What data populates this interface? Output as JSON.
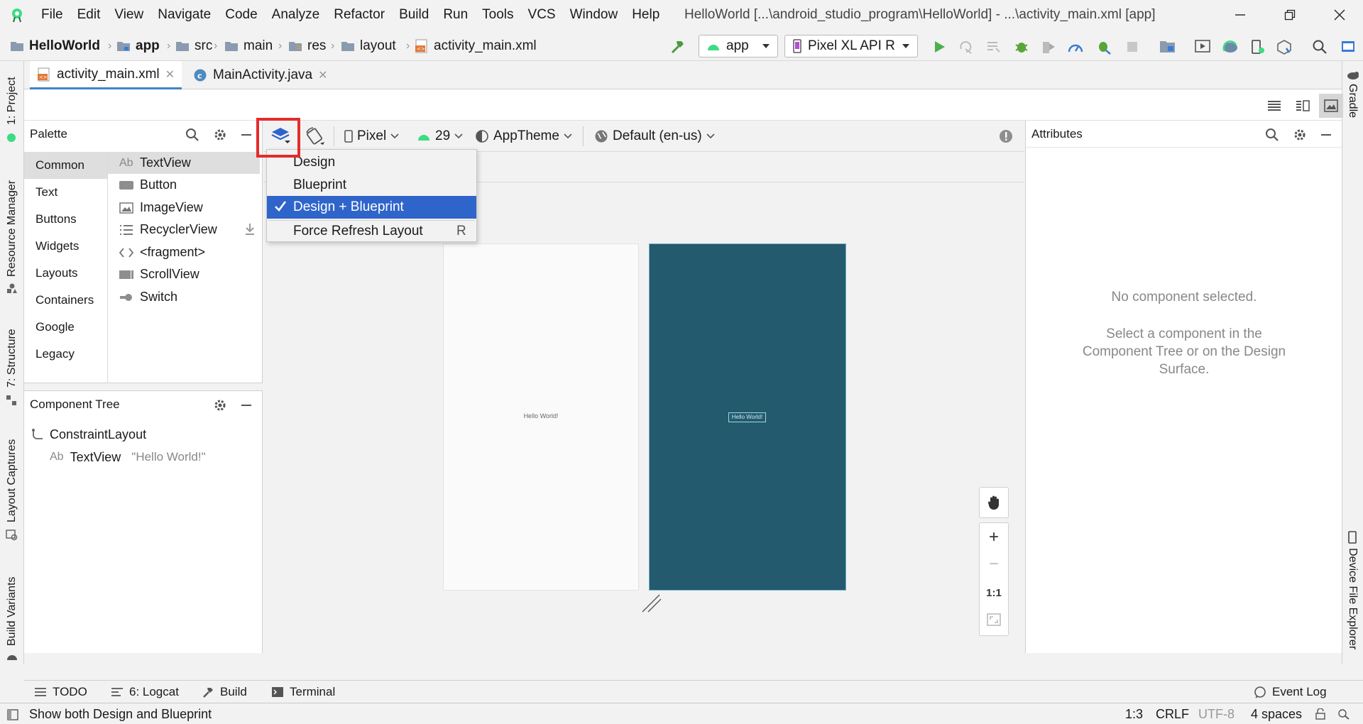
{
  "menu": [
    "File",
    "Edit",
    "View",
    "Navigate",
    "Code",
    "Analyze",
    "Refactor",
    "Build",
    "Run",
    "Tools",
    "VCS",
    "Window",
    "Help"
  ],
  "window_title": "HelloWorld [...\\android_studio_program\\HelloWorld] - ...\\activity_main.xml [app]",
  "breadcrumb": [
    "HelloWorld",
    "app",
    "src",
    "main",
    "res",
    "layout",
    "activity_main.xml"
  ],
  "run_config": "app",
  "device": "Pixel XL API R",
  "editor_tabs": [
    {
      "label": "activity_main.xml",
      "active": true
    },
    {
      "label": "MainActivity.java",
      "active": false
    }
  ],
  "left_tool_tabs": [
    "1: Project",
    "Resource Manager",
    "7: Structure",
    "Layout Captures",
    "Build Variants"
  ],
  "right_tool_tabs": [
    "Gradle",
    "Device File Explorer"
  ],
  "palette": {
    "title": "Palette",
    "categories": [
      "Common",
      "Text",
      "Buttons",
      "Widgets",
      "Layouts",
      "Containers",
      "Google",
      "Legacy"
    ],
    "selected_category": "Common",
    "items": [
      {
        "icon": "Ab",
        "label": "TextView"
      },
      {
        "icon": "button",
        "label": "Button"
      },
      {
        "icon": "image",
        "label": "ImageView"
      },
      {
        "icon": "list",
        "label": "RecyclerView"
      },
      {
        "icon": "code",
        "label": "<fragment>"
      },
      {
        "icon": "scroll",
        "label": "ScrollView"
      },
      {
        "icon": "switch",
        "label": "Switch"
      }
    ]
  },
  "component_tree": {
    "title": "Component Tree",
    "root": "ConstraintLayout",
    "child_label": "TextView",
    "child_text": "\"Hello World!\"",
    "child_icon": "Ab"
  },
  "design_toolbar": {
    "device": "Pixel",
    "api": "29",
    "theme": "AppTheme",
    "locale": "Default (en-us)"
  },
  "design_menu": {
    "items": [
      "Design",
      "Blueprint",
      "Design + Blueprint",
      "Force Refresh Layout"
    ],
    "selected": "Design + Blueprint",
    "shortcut": "R"
  },
  "canvas": {
    "design_text": "Hello World!",
    "blueprint_text": "Hello World!",
    "blueprint_color": "#245a6e",
    "zoom_controls": [
      "+",
      "−",
      "1:1"
    ]
  },
  "attributes": {
    "title": "Attributes",
    "empty_title": "No component selected.",
    "empty_hint": "Select a component in the Component Tree or on the Design Surface."
  },
  "tool_windows": [
    "TODO",
    "6: Logcat",
    "Build",
    "Terminal"
  ],
  "event_log": "Event Log",
  "status": {
    "message": "Show both Design and Blueprint",
    "position": "1:3",
    "line_sep": "CRLF",
    "encoding": "UTF-8",
    "indent": "4 spaces"
  },
  "colors": {
    "accent": "#2f65ca",
    "highlight": "#e52b2b",
    "android_green": "#3ddc84"
  }
}
